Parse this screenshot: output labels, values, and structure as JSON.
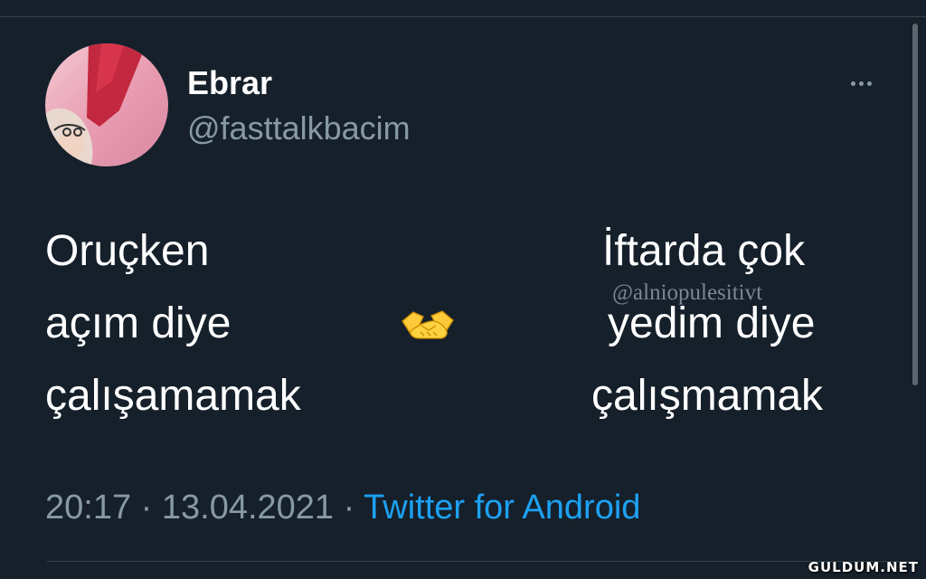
{
  "tweet": {
    "display_name": "Ebrar",
    "handle": "@fasttalkbacim",
    "left_lines": [
      "Oruçken",
      "açım diye",
      "çalışamamak"
    ],
    "right_lines": [
      "İftarda çok",
      "yedim diye",
      "çalışmamak"
    ],
    "center_icon": "handshake-emoji",
    "watermark": "@alniopulesitivt",
    "time": "20:17",
    "date": "13.04.2021",
    "separator": "·",
    "source": "Twitter for Android"
  },
  "branding": {
    "site_logo": "GULDUM.NET"
  },
  "colors": {
    "background": "#15202b",
    "text_primary": "#ffffff",
    "text_secondary": "#8899a6",
    "link": "#1da1f2",
    "divider": "#38444d"
  }
}
